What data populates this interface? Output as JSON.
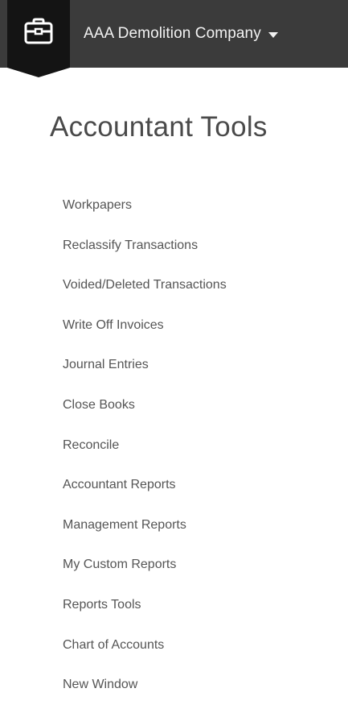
{
  "header": {
    "company_name": "AAA Demolition Company",
    "icon": "briefcase-icon",
    "dropdown_icon": "caret-down-icon",
    "bar_color": "#3b3b3b",
    "tab_color": "#141414"
  },
  "page": {
    "title": "Accountant Tools"
  },
  "menu": {
    "items": [
      {
        "label": "Workpapers"
      },
      {
        "label": "Reclassify Transactions"
      },
      {
        "label": "Voided/Deleted Transactions"
      },
      {
        "label": "Write Off Invoices"
      },
      {
        "label": "Journal Entries"
      },
      {
        "label": "Close Books"
      },
      {
        "label": "Reconcile"
      },
      {
        "label": "Accountant Reports"
      },
      {
        "label": "Management Reports"
      },
      {
        "label": "My Custom Reports"
      },
      {
        "label": "Reports Tools"
      },
      {
        "label": "Chart of Accounts"
      },
      {
        "label": "New Window"
      }
    ]
  }
}
